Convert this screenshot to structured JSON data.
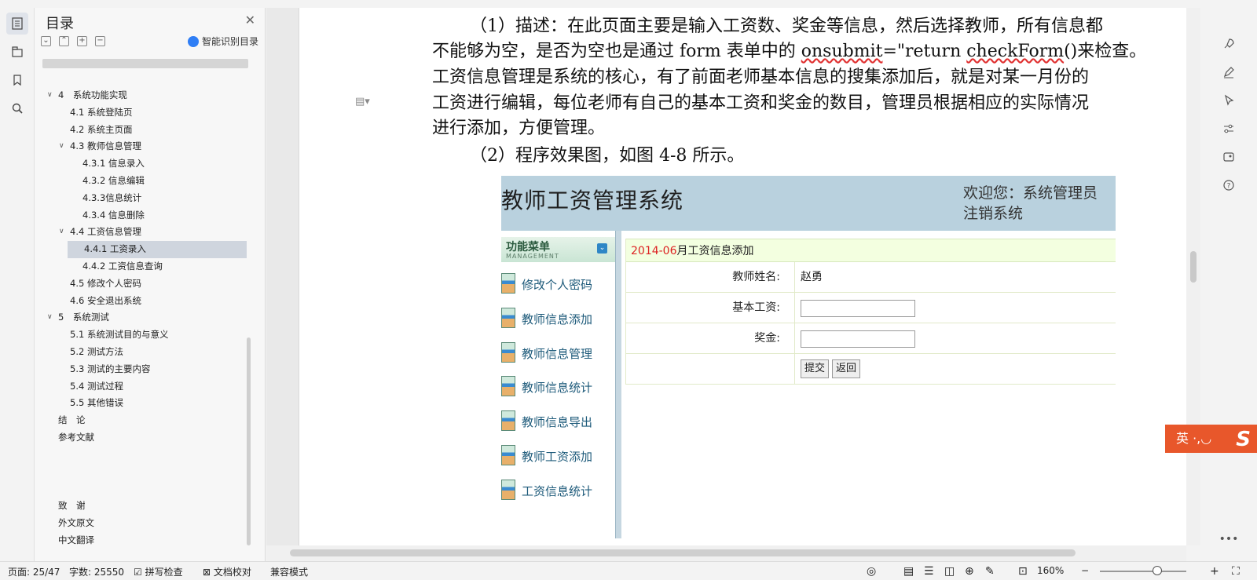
{
  "toc": {
    "title": "目录",
    "smart_label": "智能识别目录",
    "items": [
      {
        "label": "4　系统功能实现",
        "level": 1,
        "caret": "∨"
      },
      {
        "label": "4.1 系统登陆页",
        "level": 2
      },
      {
        "label": "4.2 系统主页面",
        "level": 2
      },
      {
        "label": "4.3 教师信息管理",
        "level": 2,
        "caret": "∨"
      },
      {
        "label": "4.3.1 信息录入",
        "level": 3
      },
      {
        "label": "4.3.2 信息编辑",
        "level": 3
      },
      {
        "label": "4.3.3信息统计",
        "level": 3
      },
      {
        "label": "4.3.4 信息删除",
        "level": 3
      },
      {
        "label": "4.4 工资信息管理",
        "level": 2,
        "caret": "∨"
      },
      {
        "label": "4.4.1 工资录入",
        "level": 3,
        "selected": true
      },
      {
        "label": "4.4.2 工资信息查询",
        "level": 3
      },
      {
        "label": "4.5 修改个人密码",
        "level": 2
      },
      {
        "label": "4.6 安全退出系统",
        "level": 2
      },
      {
        "label": "5　系统测试",
        "level": 1,
        "caret": "∨"
      },
      {
        "label": "5.1 系统测试目的与意义",
        "level": 2
      },
      {
        "label": "5.2 测试方法",
        "level": 2
      },
      {
        "label": "5.3 测试的主要内容",
        "level": 2
      },
      {
        "label": "5.4 测试过程",
        "level": 2
      },
      {
        "label": "5.5 其他错误",
        "level": 2
      },
      {
        "label": "结　论",
        "level": 1
      },
      {
        "label": "参考文献",
        "level": 1
      },
      {
        "label": "",
        "level": 1
      },
      {
        "label": "",
        "level": 1
      },
      {
        "label": "",
        "level": 1
      },
      {
        "label": "致　谢",
        "level": 1
      },
      {
        "label": "外文原文",
        "level": 1
      },
      {
        "label": "中文翻译",
        "level": 1
      }
    ]
  },
  "doc": {
    "p1_l1": "（1）描述：在此页面主要是输入工资数、奖金等信息，然后选择教师，所有信息都",
    "p1_l2a": "不能够为空，是否为空也是通过 form 表单中的 ",
    "p1_l2b": "onsubmit",
    "p1_l2c": "=\"return ",
    "p1_l2d": "checkForm",
    "p1_l2e": "()来检查。",
    "p1_l3": "工资信息管理是系统的核心，有了前面老师基本信息的搜集添加后，就是对某一月份的",
    "p1_l4": "工资进行编辑，每位老师有自己的基本工资和奖金的数目，管理员根据相应的实际情况",
    "p1_l5": "进行添加，方便管理。",
    "p2": "（2）程序效果图，如图 4-8 所示。"
  },
  "shot": {
    "title": "教师工资管理系统",
    "welcome": "欢迎您：系统管理员",
    "logout": "注销系统",
    "menu_title": "功能菜单",
    "menu_sub": "MANAGEMENT",
    "menu_items": [
      "修改个人密码",
      "教师信息添加",
      "教师信息管理",
      "教师信息统计",
      "教师信息导出",
      "教师工资添加",
      "工资信息统计"
    ],
    "form_date": "2014-06",
    "form_title": "月工资信息添加",
    "teacher_label": "教师姓名:",
    "teacher_value": "赵勇",
    "salary_label": "基本工资:",
    "bonus_label": "奖金:",
    "submit": "提交",
    "back": "返回"
  },
  "ime": {
    "label": "英 ·,◡",
    "logo": "S"
  },
  "status": {
    "page": "页面: 25/47",
    "words": "字数: 25550",
    "spell": "拼写检查",
    "proof": "文档校对",
    "compat": "兼容模式",
    "zoom": "160%"
  }
}
